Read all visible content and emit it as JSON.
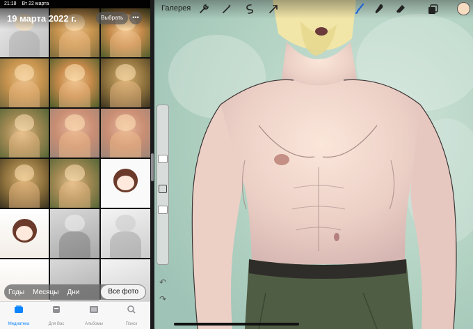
{
  "status_bar": {
    "time": "21:18",
    "date": "Вт 22 марта"
  },
  "photos": {
    "date_title": "19 марта 2022 г.",
    "select_label": "Выбрать",
    "more_label": "•••",
    "segment": [
      "Годы",
      "Месяцы",
      "Дни",
      "Все фото"
    ],
    "active_segment": "Все фото",
    "tabs": [
      {
        "label": "Медиатека",
        "icon": "photo-library-icon",
        "active": true
      },
      {
        "label": "Для Вас",
        "icon": "for-you-icon",
        "active": false
      },
      {
        "label": "Альбомы",
        "icon": "albums-icon",
        "active": false
      },
      {
        "label": "Поиск",
        "icon": "search-icon",
        "active": false
      }
    ],
    "thumbnails": 18
  },
  "procreate": {
    "gallery_label": "Галерея",
    "tools_left": [
      "wrench-icon",
      "magic-wand-icon",
      "selection-icon",
      "transform-arrow-icon"
    ],
    "tools_right": [
      "brush-icon",
      "smudge-icon",
      "eraser-icon",
      "layers-icon"
    ],
    "current_color": "#f6dcc0",
    "sidebar": {
      "undo_icon": "undo-icon",
      "redo_icon": "redo-icon",
      "modifier_icon": "modifier-square-icon"
    }
  }
}
